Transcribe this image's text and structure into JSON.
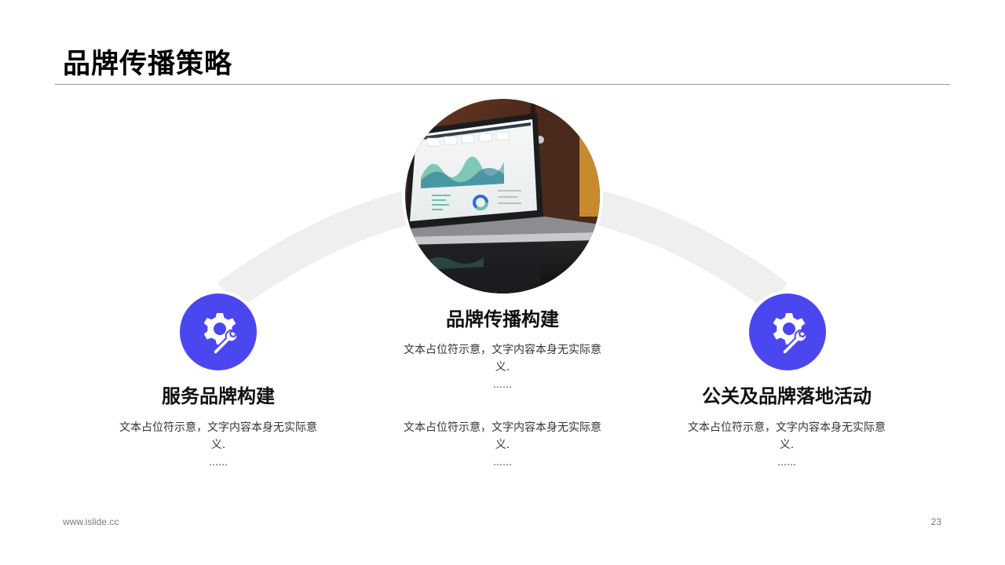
{
  "page": {
    "title": "品牌传播策略",
    "footer_url": "www.islide.cc",
    "page_number": "23"
  },
  "colors": {
    "accent": "#4b47f0",
    "arc": "#efefef",
    "text": "#111111"
  },
  "center": {
    "image": "laptop-analytics-dashboard-photo",
    "heading": "品牌传播构建",
    "blocks": [
      {
        "text": "文本占位符示意，文字内容本身无实际意义.",
        "ellipsis": "……"
      },
      {
        "text": "文本占位符示意，文字内容本身无实际意义.",
        "ellipsis": "……"
      }
    ]
  },
  "left": {
    "icon": "gear-wrench-icon",
    "heading": "服务品牌构建",
    "text": "文本占位符示意，文字内容本身无实际意义.",
    "ellipsis": "……"
  },
  "right": {
    "icon": "gear-wrench-icon",
    "heading": "公关及品牌落地活动",
    "text": "文本占位符示意，文字内容本身无实际意义.",
    "ellipsis": "……"
  }
}
